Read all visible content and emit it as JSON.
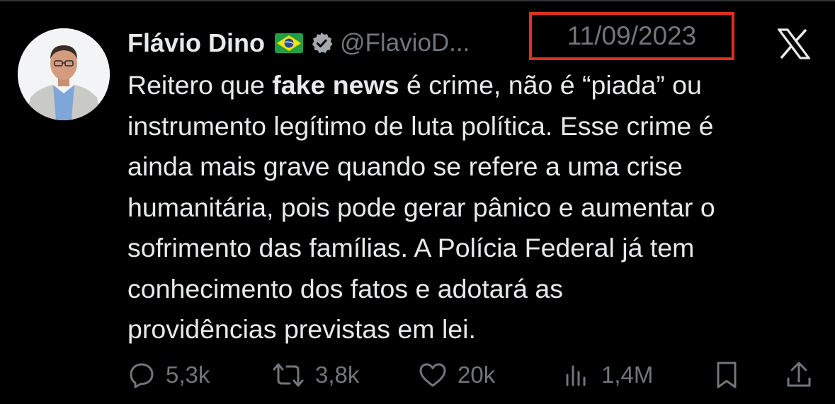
{
  "tweet": {
    "author_name": "Flávio Dino",
    "flag_icon": "brazil-flag-icon",
    "verified_icon": "verified-badge-icon",
    "handle": "@FlavioD...",
    "date": "11/09/2023",
    "highlight_color": "#e0301e",
    "text": {
      "line1_pre": "Reitero que ",
      "line1_bold": "fake news",
      "line1_post": " é crime, não é “piada” ou",
      "line2": "instrumento legítimo de luta política. Esse crime é",
      "line3": "ainda mais grave quando se refere a uma crise",
      "line4": "humanitária, pois pode gerar pânico e aumentar o",
      "line5": "sofrimento das famílias. A Polícia Federal já tem",
      "line6": "conhecimento dos fatos e adotará as",
      "line7": "providências previstas em lei."
    },
    "actions": {
      "replies": "5,3k",
      "reposts": "3,8k",
      "likes": "20k",
      "views": "1,4M"
    }
  },
  "icons": {
    "logo": "x-logo-icon",
    "reply": "reply-icon",
    "repost": "repost-icon",
    "like": "heart-icon",
    "views": "views-icon",
    "bookmark": "bookmark-icon",
    "share": "share-icon"
  }
}
